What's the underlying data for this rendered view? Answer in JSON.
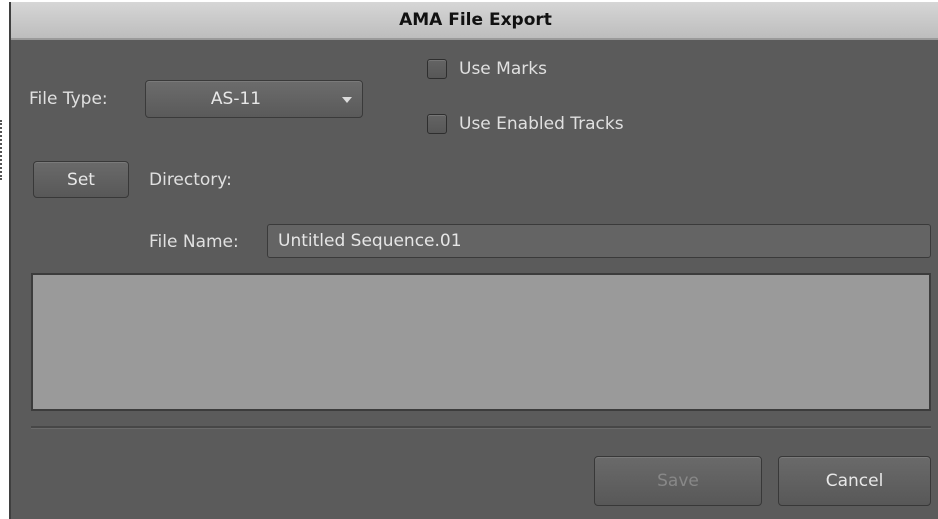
{
  "dialog": {
    "title": "AMA File Export"
  },
  "file_type": {
    "label": "File Type:",
    "selected": "AS-11"
  },
  "options": {
    "use_marks": {
      "label": "Use Marks",
      "checked": false
    },
    "use_enabled_tracks": {
      "label": "Use Enabled Tracks",
      "checked": false
    }
  },
  "directory": {
    "set_label": "Set",
    "label": "Directory:"
  },
  "file_name": {
    "label": "File Name:",
    "value": "Untitled Sequence.01"
  },
  "buttons": {
    "save_label": "Save",
    "cancel_label": "Cancel"
  }
}
